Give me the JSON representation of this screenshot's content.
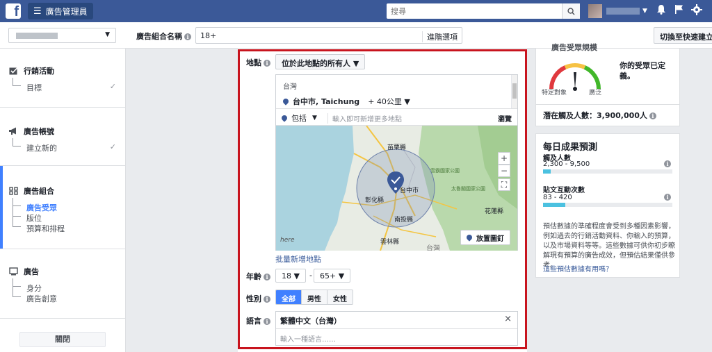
{
  "topbar": {
    "logo_letter": "f",
    "menu_label": "廣告管理員",
    "search_placeholder": "搜尋"
  },
  "subbar": {
    "adset_name_label": "廣告組合名稱",
    "adset_name_value": "18+",
    "advanced_options": "進階選項",
    "quick_create": "切換至快速建立流程"
  },
  "sidebar": {
    "campaign": {
      "title": "行銷活動",
      "items": [
        "目標"
      ]
    },
    "account": {
      "title": "廣告帳號",
      "items": [
        "建立新的"
      ]
    },
    "adset": {
      "title": "廣告組合",
      "items": [
        "廣告受眾",
        "版位",
        "預算和排程"
      ],
      "active_item": "廣告受眾"
    },
    "ad": {
      "title": "廣告",
      "items": [
        "身分",
        "廣告創意"
      ]
    },
    "close_label": "關閉"
  },
  "audience": {
    "location_label": "地點",
    "location_mode": "位於此地點的所有人",
    "country": "台灣",
    "city": "台中市, Taichung",
    "radius": "+ 40公里",
    "include_label": "包括",
    "location_input_placeholder": "輸入即可新增更多地點",
    "browse": "瀏覽",
    "map_labels": {
      "miaoli": "苗栗縣",
      "taichung": "台中市",
      "changhua": "彰化縣",
      "nantou": "南投縣",
      "yunlin": "雲林縣",
      "hualien": "花蓮縣",
      "taiwan": "台灣",
      "park1": "雪霸國家公園",
      "park2": "太魯閣國家公園",
      "watermark": "here"
    },
    "drop_pin": "放置圖釘",
    "bulk_add": "批量新增地點",
    "age_label": "年齡",
    "age_min": "18",
    "age_max": "65+",
    "age_sep": "-",
    "gender_label": "性別",
    "gender_options": [
      "全部",
      "男性",
      "女性"
    ],
    "gender_selected": "全部",
    "language_label": "語言",
    "language_selected": "繁體中文（台灣）",
    "language_placeholder": "輸入一種語言……"
  },
  "audience_def": {
    "title": "廣告受眾規模",
    "status": "你的受眾已定義。",
    "specific": "特定對象",
    "broad": "廣泛",
    "potential_reach": "潛在觸及人數：3,900,000人"
  },
  "estimate": {
    "title": "每日成果預測",
    "reach_label": "觸及人數",
    "reach_range": "2,300 - 9,500",
    "reach_fill": 0.06,
    "engage_label": "貼文互動次數",
    "engage_range": "83 - 420",
    "engage_fill": 0.17,
    "note": "預估數據的準確程度會受到多種因素影響，例如過去的行銷活動資料、你輸入的預算，以及市場資料等等。這些數據可供你初步瞭解現有預算的廣告成效，但預估結果僅供參考。",
    "help_link": "這些預估數據有用嗎？"
  },
  "colors": {
    "brand": "#3b5998",
    "accent": "#4080ff",
    "highlight_frame": "#c8141e"
  }
}
